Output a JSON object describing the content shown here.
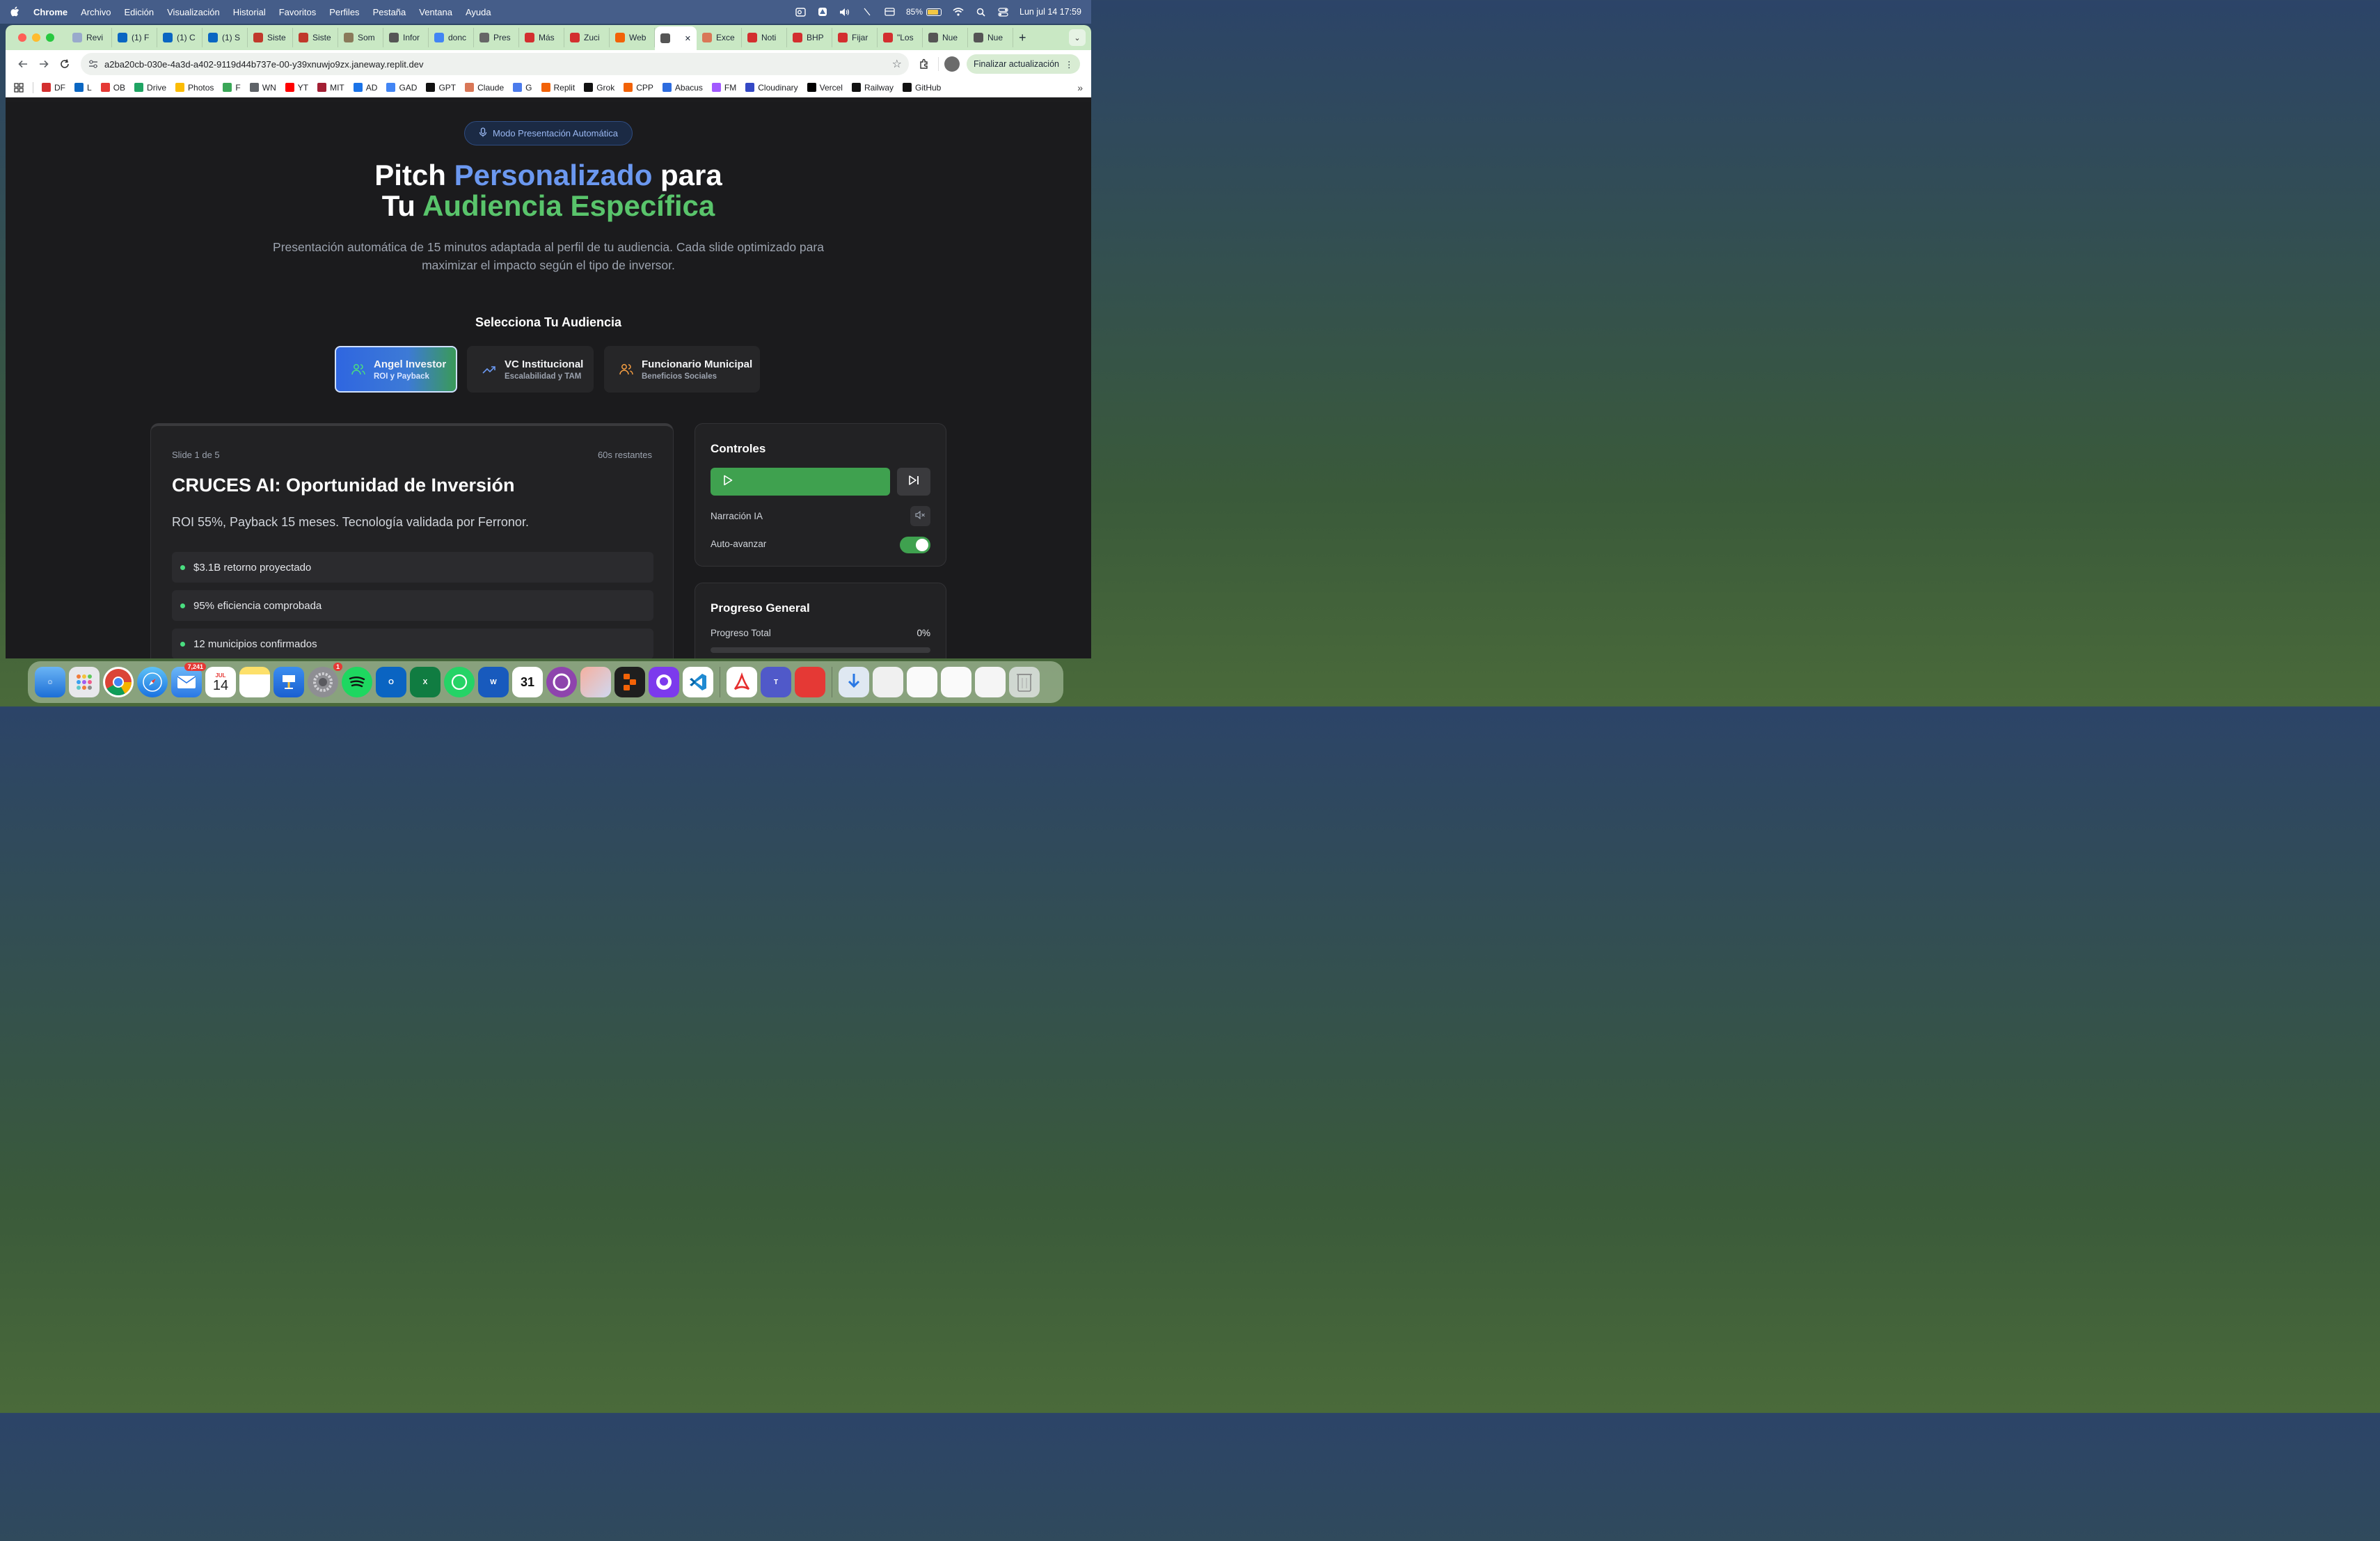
{
  "menubar": {
    "app": "Chrome",
    "items": [
      "Archivo",
      "Edición",
      "Visualización",
      "Historial",
      "Favoritos",
      "Perfiles",
      "Pestaña",
      "Ventana",
      "Ayuda"
    ],
    "battery": "85%",
    "datetime": "Lun jul 14  17:59"
  },
  "tabs": [
    {
      "label": "Revi",
      "color": "#9ac"
    },
    {
      "label": "(1) F",
      "color": "#0a66c2"
    },
    {
      "label": "(1) C",
      "color": "#0a66c2"
    },
    {
      "label": "(1) S",
      "color": "#0a66c2"
    },
    {
      "label": "Siste",
      "color": "#c0392b"
    },
    {
      "label": "Siste",
      "color": "#c0392b"
    },
    {
      "label": "Som",
      "color": "#8a7a5a"
    },
    {
      "label": "Infor",
      "color": "#555"
    },
    {
      "label": "donc",
      "color": "#4285f4"
    },
    {
      "label": "Pres",
      "color": "#666"
    },
    {
      "label": "Más",
      "color": "#d32f2f"
    },
    {
      "label": "Zuci",
      "color": "#d32f2f"
    },
    {
      "label": "Web",
      "color": "#f26207"
    },
    {
      "label": "",
      "color": "#555",
      "active": true
    },
    {
      "label": "Exce",
      "color": "#d97757"
    },
    {
      "label": "Noti",
      "color": "#d32f2f"
    },
    {
      "label": "BHP",
      "color": "#d32f2f"
    },
    {
      "label": "Fijar",
      "color": "#d32f2f"
    },
    {
      "label": "\"Los",
      "color": "#d32f2f"
    },
    {
      "label": "Nue",
      "color": "#555"
    },
    {
      "label": "Nue",
      "color": "#555"
    }
  ],
  "omnibox": {
    "url": "a2ba20cb-030e-4a3d-a402-9119d44b737e-00-y39xnuwjo9zx.janeway.replit.dev"
  },
  "update_button": "Finalizar actualización",
  "bookmarks": [
    {
      "label": "DF",
      "color": "#d32f2f"
    },
    {
      "label": "L",
      "color": "#0a66c2"
    },
    {
      "label": "OB",
      "color": "#e53935"
    },
    {
      "label": "Drive",
      "color": "#1fa463"
    },
    {
      "label": "Photos",
      "color": "#fbbc04"
    },
    {
      "label": "F",
      "color": "#3aa757"
    },
    {
      "label": "WN",
      "color": "#5f6368"
    },
    {
      "label": "YT",
      "color": "#ff0000"
    },
    {
      "label": "MIT",
      "color": "#a31f34"
    },
    {
      "label": "AD",
      "color": "#1a73e8"
    },
    {
      "label": "GAD",
      "color": "#4285f4"
    },
    {
      "label": "GPT",
      "color": "#111111"
    },
    {
      "label": "Claude",
      "color": "#d97757"
    },
    {
      "label": "G",
      "color": "#4b7bec"
    },
    {
      "label": "Replit",
      "color": "#f26207"
    },
    {
      "label": "Grok",
      "color": "#111111"
    },
    {
      "label": "CPP",
      "color": "#f26207"
    },
    {
      "label": "Abacus",
      "color": "#2d6cdf"
    },
    {
      "label": "FM",
      "color": "#a259ff"
    },
    {
      "label": "Cloudinary",
      "color": "#3448c5"
    },
    {
      "label": "Vercel",
      "color": "#000000"
    },
    {
      "label": "Railway",
      "color": "#111111"
    },
    {
      "label": "GitHub",
      "color": "#111111"
    }
  ],
  "page": {
    "badge": "Modo Presentación Automática",
    "headline": {
      "w1": "Pitch ",
      "w2": "Personalizado",
      "w3": " para",
      "w4": "Tu ",
      "w5": "Audiencia Específica"
    },
    "subtitle": "Presentación automática de 15 minutos adaptada al perfil de tu audiencia. Cada slide optimizado para maximizar el impacto según el tipo de inversor.",
    "select_title": "Selecciona Tu Audiencia",
    "audiences": [
      {
        "title": "Angel Investor",
        "sub": "ROI y Payback",
        "icon": "users-icon",
        "icon_color": "#4ade80"
      },
      {
        "title": "VC Institucional",
        "sub": "Escalabilidad y TAM",
        "icon": "trending-up-icon",
        "icon_color": "#6b98f0"
      },
      {
        "title": "Funcionario Municipal",
        "sub": "Beneficios Sociales",
        "icon": "users-icon",
        "icon_color": "#f59e42"
      }
    ],
    "slide": {
      "counter": "Slide 1 de 5",
      "remaining": "60s restantes",
      "title": "CRUCES AI: Oportunidad de Inversión",
      "desc": "ROI 55%, Payback 15 meses. Tecnología validada por Ferronor.",
      "bullets": [
        "$3.1B retorno proyectado",
        "95% eficiencia comprobada",
        "12 municipios confirmados"
      ]
    },
    "controls": {
      "title": "Controles",
      "narration_label": "Narración IA",
      "auto_label": "Auto-avanzar",
      "auto_on": true
    },
    "progress": {
      "title": "Progreso General",
      "label": "Progreso Total",
      "value_text": "0%",
      "value": 0
    }
  },
  "dock": {
    "mail_badge": "7,241",
    "calendar_month": "JUL",
    "calendar_day": "14",
    "settings_badge": "1"
  }
}
